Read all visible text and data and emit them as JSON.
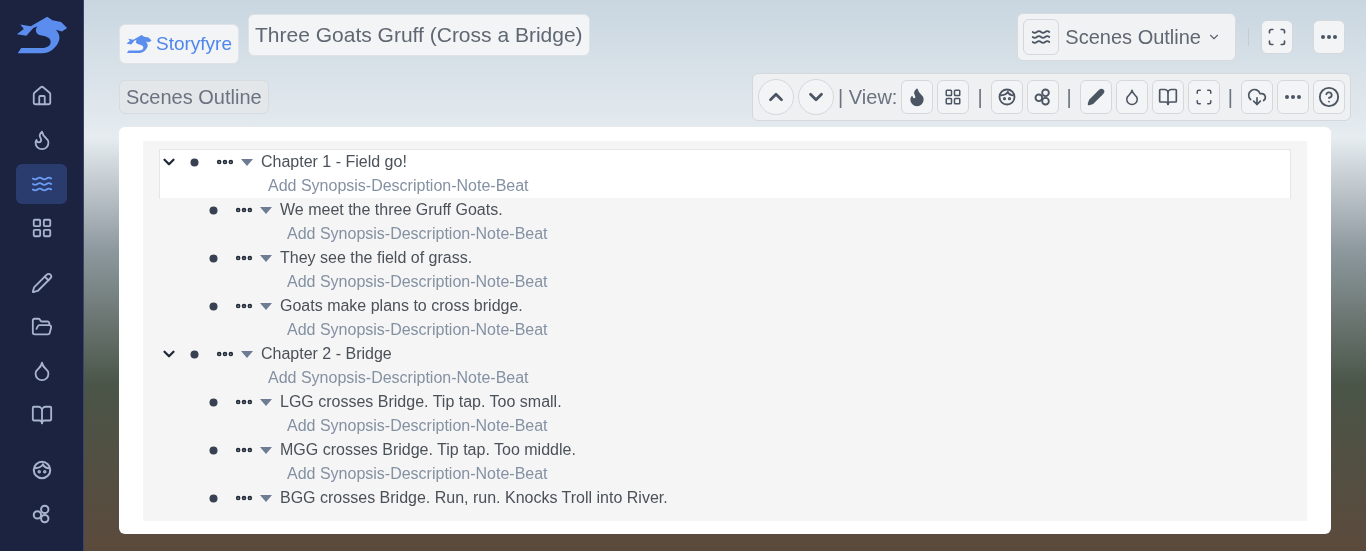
{
  "sidebar": {
    "items": [
      {
        "selected": false
      },
      {
        "selected": false
      },
      {
        "selected": true
      },
      {
        "selected": false
      },
      {
        "selected": false
      },
      {
        "selected": false
      },
      {
        "selected": false
      },
      {
        "selected": false
      },
      {
        "selected": false
      },
      {
        "selected": false
      }
    ]
  },
  "header": {
    "app_button": "Storyfyre",
    "project_title": "Three Goats Gruff (Cross a Bridge)",
    "view_selector": "Scenes Outline",
    "section_label": "Scenes Outline"
  },
  "toolbar": {
    "view_label": "| View:",
    "separators": [
      "|",
      "|",
      "|"
    ]
  },
  "outline": [
    {
      "title": "Chapter 1 - Field go!",
      "note": "Add Synopsis-Description-Note-Beat",
      "selected": true,
      "expanded": true,
      "children": [
        {
          "title": "We meet the three Gruff Goats.",
          "note": "Add Synopsis-Description-Note-Beat",
          "selected": false
        },
        {
          "title": "They see the field of grass.",
          "note": "Add Synopsis-Description-Note-Beat",
          "selected": false
        },
        {
          "title": "Goats make plans to cross bridge.",
          "note": "Add Synopsis-Description-Note-Beat",
          "selected": false
        }
      ]
    },
    {
      "title": "Chapter 2 - Bridge",
      "note": "Add Synopsis-Description-Note-Beat",
      "selected": false,
      "expanded": true,
      "children": [
        {
          "title": "LGG crosses Bridge. Tip tap. Too small.",
          "note": "Add Synopsis-Description-Note-Beat",
          "selected": false
        },
        {
          "title": "MGG crosses Bridge. Tip tap. Too middle.",
          "note": "Add Synopsis-Description-Note-Beat",
          "selected": false
        },
        {
          "title": "BGG crosses Bridge. Run, run. Knocks Troll into River.",
          "selected": false
        }
      ]
    }
  ]
}
